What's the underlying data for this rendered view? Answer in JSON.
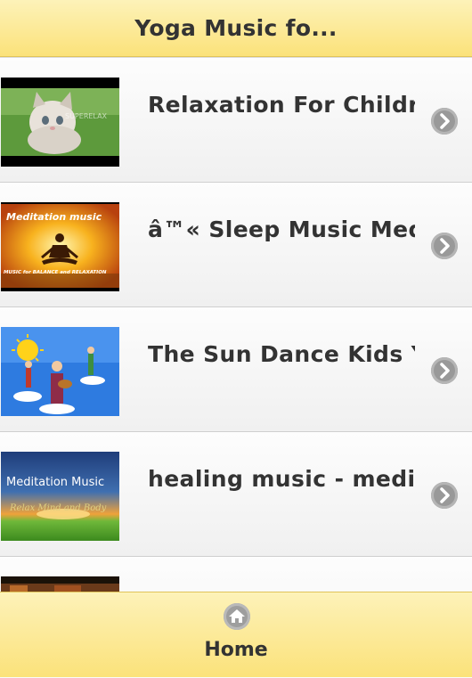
{
  "header": {
    "title": "Yoga Music fo..."
  },
  "videos": [
    {
      "title": "Relaxation For Childr...",
      "thumbnail": "kitten-on-grass"
    },
    {
      "title": "â™« Sleep Music Med...",
      "thumbnail": "meditation-silhouette",
      "thumb_text": "Meditation music",
      "thumb_subtext": "MUSIC for BALANCE and RELAXATION"
    },
    {
      "title": "The Sun Dance Kids Y...",
      "thumbnail": "kids-dancing-cartoon"
    },
    {
      "title": "healing music - medi...",
      "thumbnail": "meditation-sunset-landscape",
      "thumb_text": "Meditation Music",
      "thumb_subtext": "Relax Mind and Body"
    },
    {
      "title": "",
      "thumbnail": "partial-thumbnail"
    }
  ],
  "footer": {
    "home_label": "Home",
    "home_icon": "home-icon"
  },
  "colors": {
    "bar_top": "#fdf2b9",
    "bar_bottom": "#fbe27a",
    "text": "#333333",
    "chevron": "#999999"
  }
}
